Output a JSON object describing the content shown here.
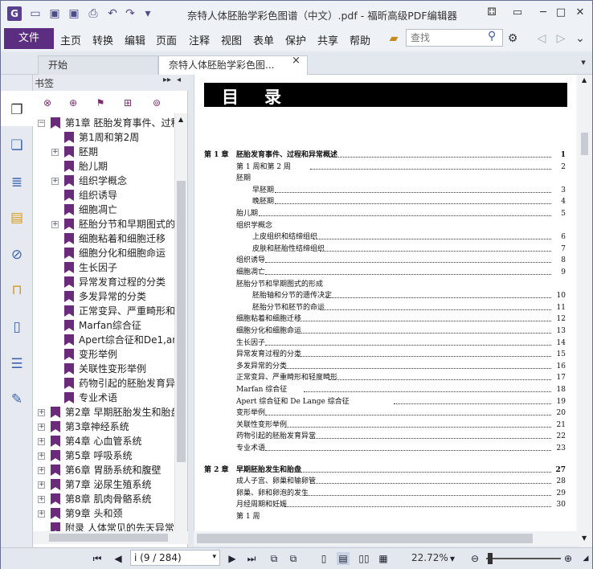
{
  "titlebar": {
    "title": "奈特人体胚胎学彩色图谱（中文）.pdf - 福昕高级PDF编辑器",
    "min": "▭",
    "max": "─",
    "restore": "□",
    "close": "✕",
    "extra": "⚃"
  },
  "menubar": {
    "file": "文件",
    "items": [
      "主页",
      "转换",
      "编辑",
      "页面",
      "注释",
      "视图",
      "表单",
      "保护",
      "共享",
      "帮助"
    ],
    "search_placeholder": "查找"
  },
  "tabs": {
    "start": "开始",
    "doc": "奈特人体胚胎学彩色图...",
    "close": "×"
  },
  "bookmarks": {
    "header": "书签",
    "rows": [
      {
        "level": 0,
        "exp": "−",
        "text": "第1章 胚胎发育事件、过程"
      },
      {
        "level": 1,
        "exp": "",
        "text": "第1周和第2周"
      },
      {
        "level": 1,
        "exp": "+",
        "text": "胚期"
      },
      {
        "level": 1,
        "exp": "",
        "text": "胎儿期"
      },
      {
        "level": 1,
        "exp": "+",
        "text": "组织学概念"
      },
      {
        "level": 1,
        "exp": "",
        "text": "组织诱导"
      },
      {
        "level": 1,
        "exp": "",
        "text": "细胞凋亡"
      },
      {
        "level": 1,
        "exp": "+",
        "text": "胚胎分节和早期图式的"
      },
      {
        "level": 1,
        "exp": "",
        "text": "细胞粘着和细胞迁移"
      },
      {
        "level": 1,
        "exp": "",
        "text": "细胞分化和细胞命运"
      },
      {
        "level": 1,
        "exp": "",
        "text": "生长因子"
      },
      {
        "level": 1,
        "exp": "",
        "text": "异常发育过程的分类"
      },
      {
        "level": 1,
        "exp": "",
        "text": "多发异常的分类"
      },
      {
        "level": 1,
        "exp": "",
        "text": "正常变异、严重畸形和"
      },
      {
        "level": 1,
        "exp": "",
        "text": "Marfan综合征"
      },
      {
        "level": 1,
        "exp": "",
        "text": "Apert综合征和De1,an"
      },
      {
        "level": 1,
        "exp": "",
        "text": "变形举例"
      },
      {
        "level": 1,
        "exp": "",
        "text": "关联性变形举例"
      },
      {
        "level": 1,
        "exp": "",
        "text": "药物引起的胚胎发育异"
      },
      {
        "level": 1,
        "exp": "",
        "text": "专业术语"
      },
      {
        "level": 0,
        "exp": "+",
        "text": "第2章 早期胚胎发生和胎盘"
      },
      {
        "level": 0,
        "exp": "+",
        "text": "第3章神经系统"
      },
      {
        "level": 0,
        "exp": "+",
        "text": "第4章 心血管系统"
      },
      {
        "level": 0,
        "exp": "+",
        "text": "第5章 呼吸系统"
      },
      {
        "level": 0,
        "exp": "+",
        "text": "第6章 胃肠系统和腹壁"
      },
      {
        "level": 0,
        "exp": "+",
        "text": "第7章 泌尿生殖系统"
      },
      {
        "level": 0,
        "exp": "+",
        "text": "第8章 肌肉骨骼系统"
      },
      {
        "level": 0,
        "exp": "+",
        "text": "第9章 头和颈"
      },
      {
        "level": 0,
        "exp": "",
        "text": "附录 人体常见的先天异常"
      }
    ]
  },
  "toc": {
    "title": "目录",
    "lines": [
      {
        "ch": "第 1 章",
        "text": "胚胎发育事件、过程和异常概述",
        "page": "1",
        "ind": 0,
        "bold": true
      },
      {
        "ch": "",
        "text": "第 1 周和第 2 周",
        "page": "2",
        "ind": 1
      },
      {
        "ch": "",
        "text": "胚期",
        "page": "",
        "ind": 1
      },
      {
        "ch": "",
        "text": "早胚期",
        "page": "3",
        "ind": 2
      },
      {
        "ch": "",
        "text": "晚胚期",
        "page": "4",
        "ind": 2
      },
      {
        "ch": "",
        "text": "胎儿期",
        "page": "5",
        "ind": 1
      },
      {
        "ch": "",
        "text": "组织学概念",
        "page": "",
        "ind": 1
      },
      {
        "ch": "",
        "text": "上皮组织和结缔组织",
        "page": "6",
        "ind": 2
      },
      {
        "ch": "",
        "text": "皮肤和胚胎性结缔组织",
        "page": "7",
        "ind": 2
      },
      {
        "ch": "",
        "text": "组织诱导",
        "page": "8",
        "ind": 1
      },
      {
        "ch": "",
        "text": "细胞凋亡",
        "page": "9",
        "ind": 1
      },
      {
        "ch": "",
        "text": "胚胎分节和早期图式的形成",
        "page": "",
        "ind": 1
      },
      {
        "ch": "",
        "text": "胚胎轴和分节的遗传决定",
        "page": "10",
        "ind": 2
      },
      {
        "ch": "",
        "text": "胚胎分节和胚节的命运",
        "page": "11",
        "ind": 2
      },
      {
        "ch": "",
        "text": "细胞粘着和细胞迁移",
        "page": "12",
        "ind": 1
      },
      {
        "ch": "",
        "text": "细胞分化和细胞命运",
        "page": "13",
        "ind": 1
      },
      {
        "ch": "",
        "text": "生长因子",
        "page": "14",
        "ind": 1
      },
      {
        "ch": "",
        "text": "异常发育过程的分类",
        "page": "15",
        "ind": 1
      },
      {
        "ch": "",
        "text": "多发异常的分类",
        "page": "16",
        "ind": 1
      },
      {
        "ch": "",
        "text": "正常变异、严重畸形和轻度畸形",
        "page": "17",
        "ind": 1
      },
      {
        "ch": "",
        "text": "Marfan 综合征",
        "page": "18",
        "ind": 1
      },
      {
        "ch": "",
        "text": "Apert 综合征和 De  Lange 综合征",
        "page": "19",
        "ind": 1
      },
      {
        "ch": "",
        "text": "变形举例",
        "page": "20",
        "ind": 1
      },
      {
        "ch": "",
        "text": "关联性变形举例",
        "page": "21",
        "ind": 1
      },
      {
        "ch": "",
        "text": "药物引起的胚胎发育异常",
        "page": "22",
        "ind": 1
      },
      {
        "ch": "",
        "text": "专业术语",
        "page": "23",
        "ind": 1
      },
      {
        "ch": "第 2 章",
        "text": "早期胚胎发生和胎盘",
        "page": "27",
        "ind": 0,
        "bold": true
      },
      {
        "ch": "",
        "text": "成人子宫、卵巢和输卵管",
        "page": "28",
        "ind": 1
      },
      {
        "ch": "",
        "text": "卵巢、卵和卵泡的发生",
        "page": "29",
        "ind": 1
      },
      {
        "ch": "",
        "text": "月经周期和妊娠",
        "page": "30",
        "ind": 1
      },
      {
        "ch": "",
        "text": "第 1 周",
        "page": "",
        "ind": 1
      }
    ]
  },
  "status": {
    "page_field": "i (9 / 284)",
    "zoom": "22.72%"
  }
}
